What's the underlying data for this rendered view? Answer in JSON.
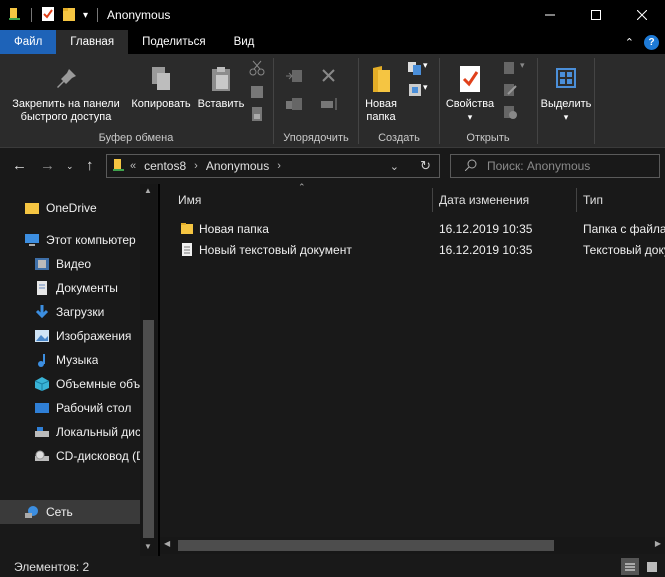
{
  "window": {
    "title": "Anonymous"
  },
  "ribbon_tabs": [
    "Файл",
    "Главная",
    "Поделиться",
    "Вид"
  ],
  "ribbon": {
    "clipboard": {
      "pin_label_1": "Закрепить на панели",
      "pin_label_2": "быстрого доступа",
      "copy_label": "Копировать",
      "paste_label": "Вставить",
      "group_label": "Буфер обмена"
    },
    "organize": {
      "group_label": "Упорядочить"
    },
    "create": {
      "new_folder_1": "Новая",
      "new_folder_2": "папка",
      "group_label": "Создать"
    },
    "open": {
      "properties_label": "Свойства",
      "group_label": "Открыть"
    },
    "select": {
      "select_label": "Выделить"
    }
  },
  "address": {
    "overflow": "«",
    "crumbs": [
      "centos8",
      "Anonymous"
    ],
    "search_placeholder": "Поиск: Anonymous"
  },
  "nav_pane": {
    "items": [
      {
        "label": "OneDrive",
        "icon": "folder-icon"
      },
      {
        "label": "Этот компьютер",
        "icon": "computer-icon"
      },
      {
        "label": "Видео",
        "icon": "video-icon"
      },
      {
        "label": "Документы",
        "icon": "documents-icon"
      },
      {
        "label": "Загрузки",
        "icon": "download-icon"
      },
      {
        "label": "Изображения",
        "icon": "pictures-icon"
      },
      {
        "label": "Музыка",
        "icon": "music-icon"
      },
      {
        "label": "Объемные объ",
        "icon": "3d-objects-icon"
      },
      {
        "label": "Рабочий стол",
        "icon": "desktop-icon"
      },
      {
        "label": "Локальный дис",
        "icon": "local-disk-icon"
      },
      {
        "label": "CD-дисковод (D",
        "icon": "cd-drive-icon"
      },
      {
        "label": "Сеть",
        "icon": "network-icon"
      }
    ]
  },
  "columns": {
    "name": "Имя",
    "date": "Дата изменения",
    "type": "Тип"
  },
  "files": [
    {
      "name": "Новая папка",
      "date": "16.12.2019 10:35",
      "type": "Папка с файла",
      "icon": "folder-icon"
    },
    {
      "name": "Новый текстовый документ",
      "date": "16.12.2019 10:35",
      "type": "Текстовый доку",
      "icon": "text-file-icon"
    }
  ],
  "status": {
    "items_count": "Элементов: 2"
  },
  "colors": {
    "file_tab": "#1e63b8",
    "folder_yellow": "#f5c542",
    "background": "#191919",
    "ribbon_bg": "#2b2b2b"
  }
}
